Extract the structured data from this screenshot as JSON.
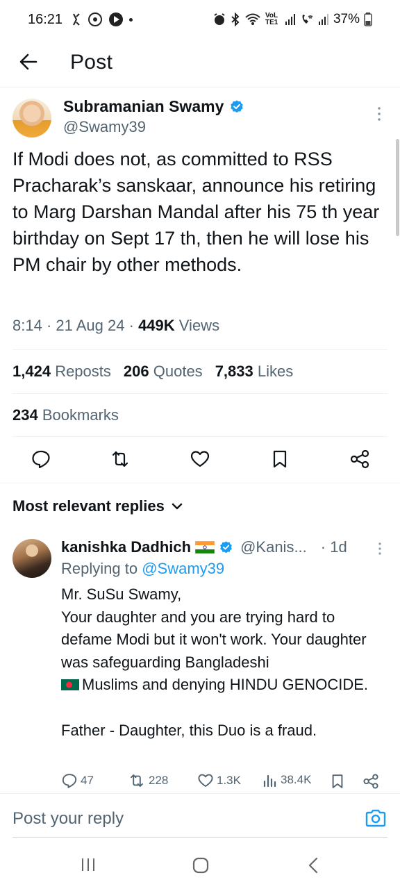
{
  "status_bar": {
    "time": "16:21",
    "battery": "37%",
    "network_label": "VoLTE1"
  },
  "app_bar": {
    "title": "Post"
  },
  "post": {
    "author_name": "Subramanian Swamy",
    "author_handle": "@Swamy39",
    "text": "If Modi does not, as  committed to RSS Pracharak’s sanskaar, announce his retiring to Marg Darshan Mandal after his 75 th year birthday on Sept 17 th, then he will lose his PM chair by other methods.",
    "time": "8:14",
    "date": "21 Aug 24",
    "views_count": "449K",
    "views_label": "Views",
    "reposts_count": "1,424",
    "reposts_label": "Reposts",
    "quotes_count": "206",
    "quotes_label": "Quotes",
    "likes_count": "7,833",
    "likes_label": "Likes",
    "bookmarks_count": "234",
    "bookmarks_label": "Bookmarks"
  },
  "replies_filter": {
    "label": "Most relevant replies"
  },
  "reply": {
    "author_name": "kanishka Dadhich",
    "author_handle": "@Kanis...",
    "age": "1d",
    "replying_prefix": "Replying to",
    "replying_to": "@Swamy39",
    "text_line1": "Mr. SuSu Swamy,\nYour daughter and you are trying hard to defame Modi but it won't work. Your daughter was safeguarding Bangladeshi",
    "text_line2": "Muslims and denying HINDU GENOCIDE.\n\nFather - Daughter, this Duo is a fraud.",
    "comments": "47",
    "reposts": "228",
    "likes": "1.3K",
    "views": "38.4K"
  },
  "composer": {
    "placeholder": "Post your reply"
  },
  "colors": {
    "accent": "#1d9bf0",
    "secondary_text": "#536471",
    "divider": "#eff3f4"
  },
  "icons": [
    "back-arrow-icon",
    "verified-badge-icon",
    "more-vertical-icon",
    "reply-icon",
    "repost-icon",
    "like-icon",
    "bookmark-icon",
    "share-icon",
    "chevron-down-icon",
    "views-icon",
    "camera-icon",
    "india-flag-icon",
    "bangladesh-flag-icon",
    "recents-icon",
    "home-icon",
    "back-nav-icon"
  ]
}
